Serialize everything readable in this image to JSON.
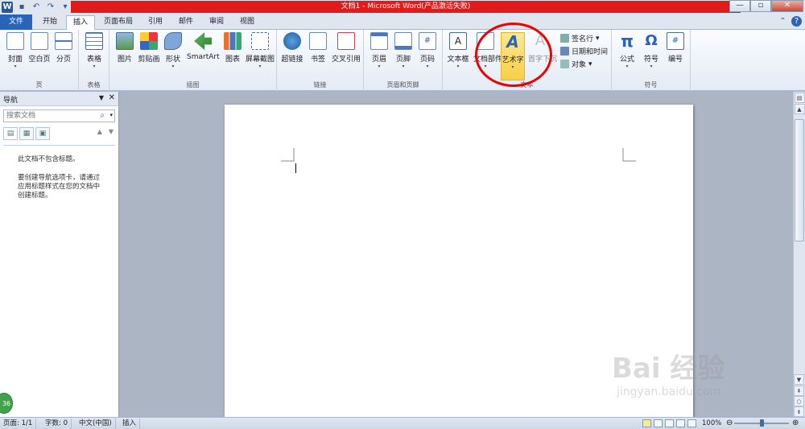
{
  "titlebar": {
    "title": "文档1 - Microsoft Word(产品激活失败)",
    "quick_access": [
      "save-icon",
      "undo-icon",
      "redo-icon",
      "customize-icon"
    ],
    "window_controls": [
      "minimize",
      "restore",
      "close"
    ],
    "close_label": "✕",
    "min_label": "—",
    "restore_label": "▫"
  },
  "tabs": {
    "file": "文件",
    "items": [
      "开始",
      "插入",
      "页面布局",
      "引用",
      "邮件",
      "审阅",
      "视图"
    ],
    "active": "插入"
  },
  "ribbon": {
    "groups": {
      "pages": {
        "label": "页",
        "buttons": [
          "封面",
          "空白页",
          "分页"
        ]
      },
      "tables": {
        "label": "表格",
        "buttons": [
          "表格"
        ]
      },
      "illustrations": {
        "label": "插图",
        "buttons": [
          "图片",
          "剪贴画",
          "形状",
          "SmartArt",
          "图表",
          "屏幕截图"
        ]
      },
      "links": {
        "label": "链接",
        "buttons": [
          "超链接",
          "书签",
          "交叉引用"
        ]
      },
      "header_footer": {
        "label": "页眉和页脚",
        "buttons": [
          "页眉",
          "页脚",
          "页码"
        ]
      },
      "text": {
        "label": "文本",
        "buttons": [
          "文本框",
          "文档部件",
          "艺术字",
          "首字下沉"
        ],
        "small": [
          "签名行",
          "日期和时间",
          "对象"
        ]
      },
      "symbols": {
        "label": "符号",
        "buttons": [
          "公式",
          "符号",
          "编号"
        ]
      }
    },
    "highlighted": "艺术字"
  },
  "nav": {
    "title": "导航",
    "search_placeholder": "搜索文档",
    "body_line1": "此文档不包含标题。",
    "body_line2": "要创建导航选项卡，请通过应用标题样式在您的文档中创建标题。"
  },
  "status": {
    "page": "页面: 1/1",
    "words": "字数: 0",
    "language": "中文(中国)",
    "mode": "插入",
    "zoom": "100%",
    "zoom_level": 1.0
  },
  "watermark": {
    "big": "Bai 经验",
    "small": "jingyan.baidu.com"
  },
  "badge": "36",
  "colors": {
    "accent": "#2a63b7",
    "title_red": "#e21a1a",
    "circle": "#e00000"
  }
}
